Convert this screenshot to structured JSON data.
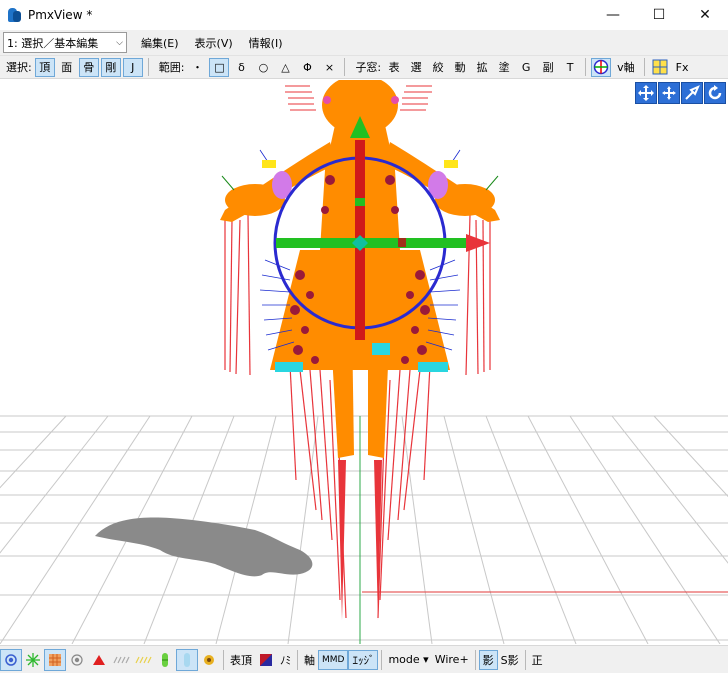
{
  "window": {
    "title": "PmxView *",
    "minimize": "—",
    "maximize": "☐",
    "close": "✕"
  },
  "menubar": {
    "mode_select": "1: 選択／基本編集",
    "items": [
      "編集(E)",
      "表示(V)",
      "情報(I)"
    ]
  },
  "toolbar": {
    "select_label": "選択:",
    "select_buttons": [
      "頂",
      "面",
      "骨",
      "剛",
      "J"
    ],
    "range_label": "範囲:",
    "range_buttons": [
      "・",
      "□",
      "δ",
      "○",
      "△",
      "Φ",
      "×"
    ],
    "child_label": "子窓:",
    "child_buttons": [
      "表",
      "選",
      "絞",
      "動",
      "拡",
      "塗",
      "G",
      "副",
      "T"
    ],
    "v_axis": "v軸",
    "fx": "Fx"
  },
  "bottombar": {
    "vertex_text": "表頂",
    "mi_text": "ﾉﾐ",
    "axis_text": "軸",
    "mmd_text": "MMD",
    "edge_text": "ｴｯｼﾞ",
    "mode_text": "mode",
    "mode_arrow": "▾",
    "wire_text": "Wire+",
    "shadow_text": "影",
    "sshadow_text": "S影",
    "front_text": "正"
  },
  "colors": {
    "model": "#ff8c00",
    "bone_red": "#e8343a",
    "gizmo_blue": "#2a2ad0",
    "gizmo_green": "#22c022",
    "grid": "#c8c8c8",
    "accent_selected": "#cce4f7"
  }
}
